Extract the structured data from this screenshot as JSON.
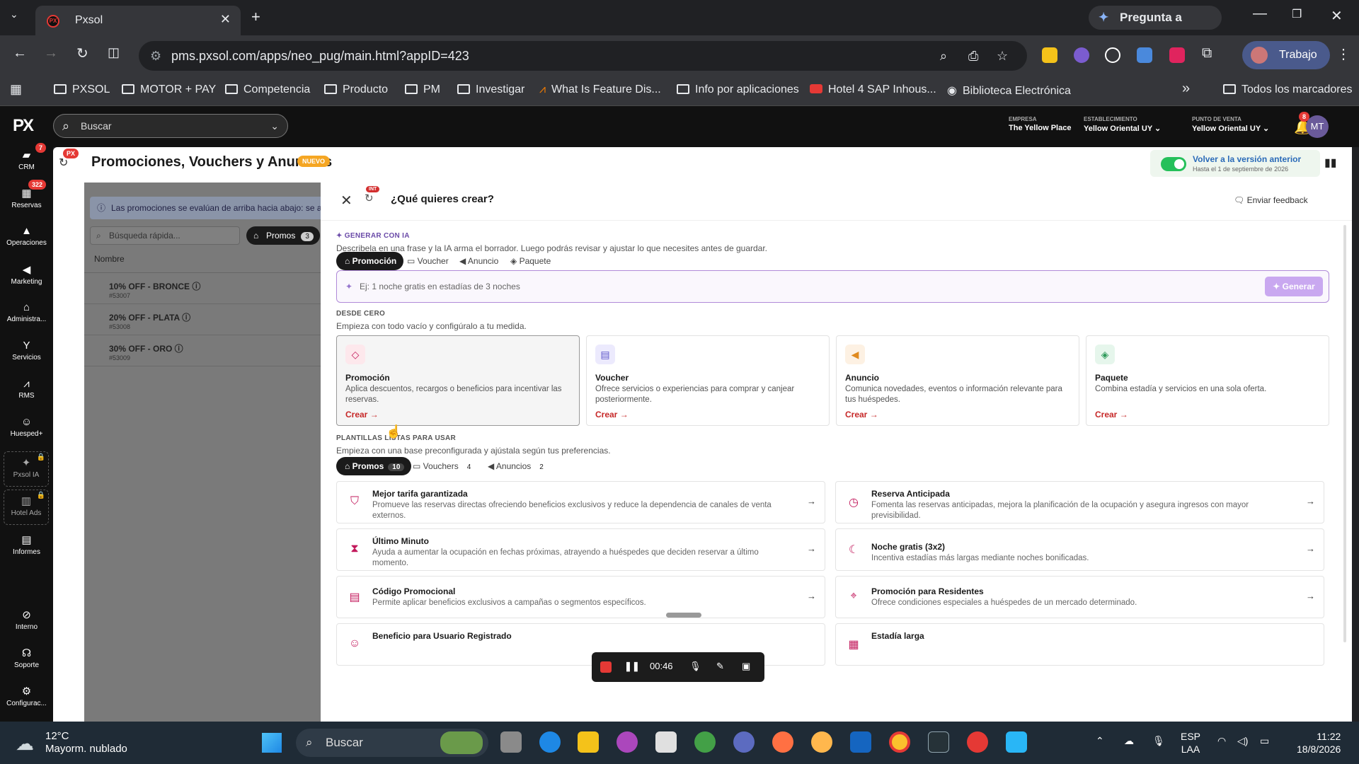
{
  "browser": {
    "tab_title": "Pxsol",
    "gemini_label": "Pregunta a Gemini",
    "url": "pms.pxsol.com/apps/neo_pug/main.html?appID=423",
    "profile_label": "Trabajo",
    "bookmarks": [
      {
        "label": "PXSOL"
      },
      {
        "label": "MOTOR + PAY"
      },
      {
        "label": "Competencia"
      },
      {
        "label": "Producto"
      },
      {
        "label": "PM"
      },
      {
        "label": "Investigar"
      },
      {
        "label": "What Is Feature Dis..."
      },
      {
        "label": "Info por aplicaciones"
      },
      {
        "label": "Hotel 4 SAP Inhous..."
      },
      {
        "label": "Biblioteca Electrónica"
      }
    ],
    "all_bookmarks": "Todos los marcadores"
  },
  "nav": {
    "logo": "PX",
    "items": [
      {
        "label": "CRM",
        "icon": "chat-icon",
        "badge": "7"
      },
      {
        "label": "Reservas",
        "icon": "calendar-icon",
        "badge": "322"
      },
      {
        "label": "Operaciones",
        "icon": "triangle-icon"
      },
      {
        "label": "Marketing",
        "icon": "megaphone-icon"
      },
      {
        "label": "Administra...",
        "icon": "home-icon"
      },
      {
        "label": "Servicios",
        "icon": "cocktail-icon"
      },
      {
        "label": "RMS",
        "icon": "chart-icon"
      },
      {
        "label": "Huesped+",
        "icon": "users-icon"
      },
      {
        "label": "Pxsol IA",
        "icon": "sparkle-icon"
      },
      {
        "label": "Hotel Ads",
        "icon": "bar-chart-icon"
      },
      {
        "label": "Informes",
        "icon": "document-icon"
      },
      {
        "label": "Interno",
        "icon": "block-icon"
      },
      {
        "label": "Soporte",
        "icon": "headset-icon"
      },
      {
        "label": "Configurac...",
        "icon": "gear-icon"
      }
    ]
  },
  "topbar": {
    "search_placeholder": "Buscar",
    "empresa_label": "EMPRESA",
    "empresa_value": "The Yellow Place",
    "establecimiento_label": "ESTABLECIMIENTO",
    "establecimiento_value": "Yellow Oriental UY",
    "punto_label": "PUNTO DE VENTA",
    "punto_value": "Yellow Oriental UY",
    "notif_count": "8",
    "avatar": "MT"
  },
  "page": {
    "title": "Promociones, Vouchers y Anuncios",
    "new_badge": "NUEVO",
    "title_badge": "PX",
    "prev_version": "Volver a la versión anterior",
    "prev_until": "Hasta el 1 de septiembre de 2026"
  },
  "list": {
    "info": "Las promociones se evalúan de arriba hacia abajo: se ap",
    "quick_search": "Búsqueda rápida...",
    "filter_label": "Promos",
    "filter_count": "3",
    "column": "Nombre",
    "rows": [
      {
        "name": "10% OFF - BRONCE",
        "id": "#53007"
      },
      {
        "name": "20% OFF - PLATA",
        "id": "#53008"
      },
      {
        "name": "30% OFF - ORO",
        "id": "#53009"
      }
    ]
  },
  "drawer": {
    "title": "¿Qué quieres crear?",
    "int_badge": "INT",
    "feedback": "Enviar feedback",
    "ai_label": "GENERAR CON IA",
    "ai_desc": "Describela en una frase y la IA arma el borrador. Luego podrás revisar y ajustar lo que necesites antes de guardar.",
    "ai_tabs": [
      "Promoción",
      "Voucher",
      "Anuncio",
      "Paquete"
    ],
    "ai_placeholder": "Ej: 1 noche gratis en estadías de 3 noches",
    "generate": "Generar",
    "scratch_label": "DESDE CERO",
    "scratch_desc": "Empieza con todo vacío y configúralo a tu medida.",
    "cards": [
      {
        "title": "Promoción",
        "desc": "Aplica descuentos, recargos o beneficios para incentivar las reservas.",
        "cta": "Crear →",
        "color": "#fde8ec",
        "icon_color": "#c2185b"
      },
      {
        "title": "Voucher",
        "desc": "Ofrece servicios o experiencias para comprar y canjear posteriormente.",
        "cta": "Crear →",
        "color": "#eceafd",
        "icon_color": "#5c55c9"
      },
      {
        "title": "Anuncio",
        "desc": "Comunica novedades, eventos o información relevante para tus huéspedes.",
        "cta": "Crear →",
        "color": "#fdf1e3",
        "icon_color": "#e08a1e"
      },
      {
        "title": "Paquete",
        "desc": "Combina estadía y servicios en una sola oferta.",
        "cta": "Crear →",
        "color": "#e6f6ec",
        "icon_color": "#2e9a5a"
      }
    ],
    "tpl_label": "PLANTILLAS LISTAS PARA USAR",
    "tpl_desc": "Empieza con una base preconfigurada y ajústala según tus preferencias.",
    "tpl_tabs": [
      {
        "label": "Promos",
        "count": "10"
      },
      {
        "label": "Vouchers",
        "count": "4"
      },
      {
        "label": "Anuncios",
        "count": "2"
      }
    ],
    "templates": [
      {
        "title": "Mejor tarifa garantizada",
        "desc": "Promueve las reservas directas ofreciendo beneficios exclusivos y reduce la dependencia de canales de venta externos.",
        "icon": "shield-icon"
      },
      {
        "title": "Reserva Anticipada",
        "desc": "Fomenta las reservas anticipadas, mejora la planificación de la ocupación y asegura ingresos con mayor previsibilidad.",
        "icon": "clock-icon"
      },
      {
        "title": "Último Minuto",
        "desc": "Ayuda a aumentar la ocupación en fechas próximas, atrayendo a huéspedes que deciden reservar a último momento.",
        "icon": "hourglass-icon"
      },
      {
        "title": "Noche gratis (3x2)",
        "desc": "Incentiva estadías más largas mediante noches bonificadas.",
        "icon": "moon-icon"
      },
      {
        "title": "Código Promocional",
        "desc": "Permite aplicar beneficios exclusivos a campañas o segmentos específicos.",
        "icon": "ticket-icon"
      },
      {
        "title": "Promoción para Residentes",
        "desc": "Ofrece condiciones especiales a huéspedes de un mercado determinado.",
        "icon": "pin-icon"
      },
      {
        "title": "Beneficio para Usuario Registrado",
        "desc": "",
        "icon": "user-icon"
      },
      {
        "title": "Estadía larga",
        "desc": "",
        "icon": "calendar-icon"
      }
    ]
  },
  "recorder": {
    "time": "00:46"
  },
  "taskbar": {
    "temp": "12°C",
    "weather": "Mayorm. nublado",
    "search": "Buscar",
    "lang1": "ESP",
    "lang2": "LAA",
    "time": "11:22",
    "date": "18/8/2026"
  }
}
